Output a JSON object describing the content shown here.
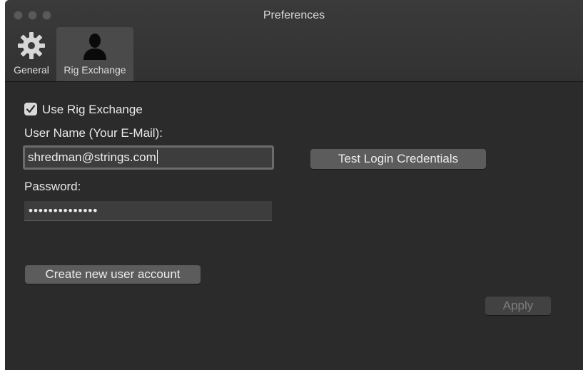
{
  "window": {
    "title": "Preferences"
  },
  "toolbar": {
    "tabs": [
      {
        "label": "General",
        "icon": "gear-icon"
      },
      {
        "label": "Rig Exchange",
        "icon": "user-silhouette-icon",
        "selected": true
      }
    ]
  },
  "form": {
    "use_rig_exchange": {
      "label": "Use Rig Exchange",
      "checked": true
    },
    "username": {
      "label": "User Name (Your E-Mail):",
      "value": "shredman@strings.com"
    },
    "password": {
      "label": "Password:",
      "value": "••••••••••••••"
    },
    "test_button": "Test Login Credentials",
    "create_button": "Create new user account",
    "apply_button": {
      "label": "Apply",
      "enabled": false
    }
  },
  "colors": {
    "background": "#2b2b2b",
    "toolbar": "#343434",
    "selected_tab": "#4a4a4a",
    "button": "#5c5c5c",
    "text": "#e8e8e8"
  }
}
